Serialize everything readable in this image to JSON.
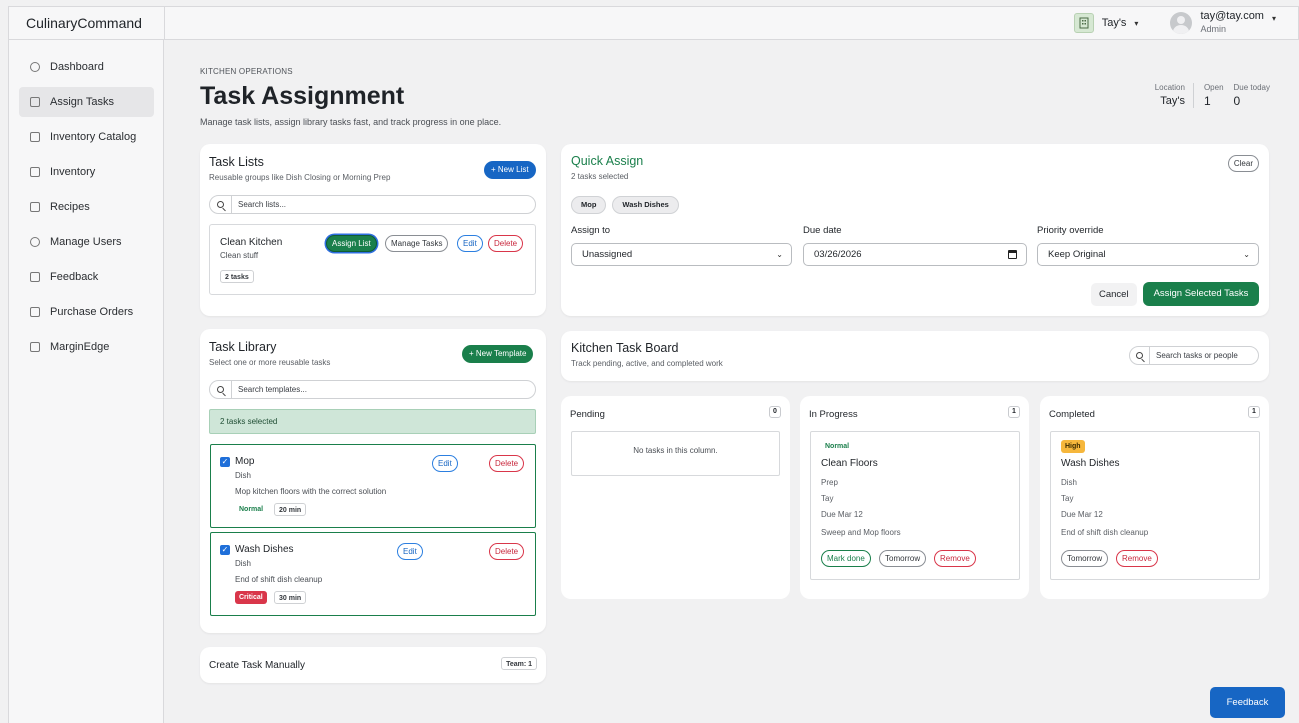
{
  "app": {
    "brand": "CulinaryCommand"
  },
  "topbar": {
    "location_label": "Tay's",
    "user_email": "tay@tay.com",
    "user_role": "Admin"
  },
  "sidebar": {
    "items": [
      {
        "label": "Dashboard",
        "icon": "gauge-icon"
      },
      {
        "label": "Assign Tasks",
        "icon": "clipboard-check-icon",
        "active": true
      },
      {
        "label": "Inventory Catalog",
        "icon": "catalog-icon"
      },
      {
        "label": "Inventory",
        "icon": "box-icon"
      },
      {
        "label": "Recipes",
        "icon": "document-icon"
      },
      {
        "label": "Manage Users",
        "icon": "users-icon"
      },
      {
        "label": "Feedback",
        "icon": "chat-icon"
      },
      {
        "label": "Purchase Orders",
        "icon": "cart-icon"
      },
      {
        "label": "MarginEdge",
        "icon": "terminal-icon"
      }
    ]
  },
  "header": {
    "kicker": "KITCHEN OPERATIONS",
    "title": "Task Assignment",
    "subtitle": "Manage task lists, assign library tasks fast, and track progress in one place.",
    "location_label": "Location",
    "location_value": "Tay's",
    "open_label": "Open",
    "open_value": "1",
    "due_label": "Due today",
    "due_value": "0"
  },
  "task_lists": {
    "title": "Task Lists",
    "subtitle": "Reusable groups like Dish Closing or Morning Prep",
    "new_button": "+ New List",
    "search_placeholder": "Search lists...",
    "item": {
      "name": "Clean Kitchen",
      "desc": "Clean stuff",
      "count": "2 tasks",
      "assign": "Assign List",
      "manage": "Manage Tasks",
      "edit": "Edit",
      "delete": "Delete"
    }
  },
  "library": {
    "title": "Task Library",
    "subtitle": "Select one or more reusable tasks",
    "new_button": "+ New Template",
    "search_placeholder": "Search templates...",
    "selected_banner": "2 tasks selected",
    "items": [
      {
        "name": "Mop",
        "category": "Dish",
        "desc": "Mop kitchen floors with the correct solution",
        "priority": "Normal",
        "duration": "20 min",
        "edit": "Edit",
        "delete": "Delete"
      },
      {
        "name": "Wash Dishes",
        "category": "Dish",
        "desc": "End of shift dish cleanup",
        "priority": "Critical",
        "duration": "30 min",
        "edit": "Edit",
        "delete": "Delete"
      }
    ]
  },
  "manual": {
    "title": "Create Task Manually",
    "team": "Team: 1"
  },
  "quick_assign": {
    "title": "Quick Assign",
    "subtitle": "2 tasks selected",
    "clear": "Clear",
    "chips": [
      "Mop",
      "Wash Dishes"
    ],
    "assign_label": "Assign to",
    "assign_value": "Unassigned",
    "due_label": "Due date",
    "due_value": "03/26/2026",
    "priority_label": "Priority override",
    "priority_value": "Keep Original",
    "cancel": "Cancel",
    "submit": "Assign Selected Tasks"
  },
  "board": {
    "title": "Kitchen Task Board",
    "subtitle": "Track pending, active, and completed work",
    "search_placeholder": "Search tasks or people",
    "columns": [
      {
        "title": "Pending",
        "count": "0",
        "empty": "No tasks in this column."
      },
      {
        "title": "In Progress",
        "count": "1",
        "card": {
          "priority": "Normal",
          "name": "Clean Floors",
          "category": "Prep",
          "assignee": "Tay",
          "due": "Due Mar 12",
          "desc": "Sweep and Mop floors",
          "done": "Mark done",
          "tomorrow": "Tomorrow",
          "remove": "Remove"
        }
      },
      {
        "title": "Completed",
        "count": "1",
        "card": {
          "priority": "High",
          "name": "Wash Dishes",
          "category": "Dish",
          "assignee": "Tay",
          "due": "Due Mar 12",
          "desc": "End of shift dish cleanup",
          "tomorrow": "Tomorrow",
          "remove": "Remove"
        }
      }
    ]
  },
  "feedback_button": "Feedback",
  "colors": {
    "green": "#1a7f4b",
    "blue": "#1766c4",
    "red": "#d9364a",
    "amber": "#f6b73c"
  }
}
